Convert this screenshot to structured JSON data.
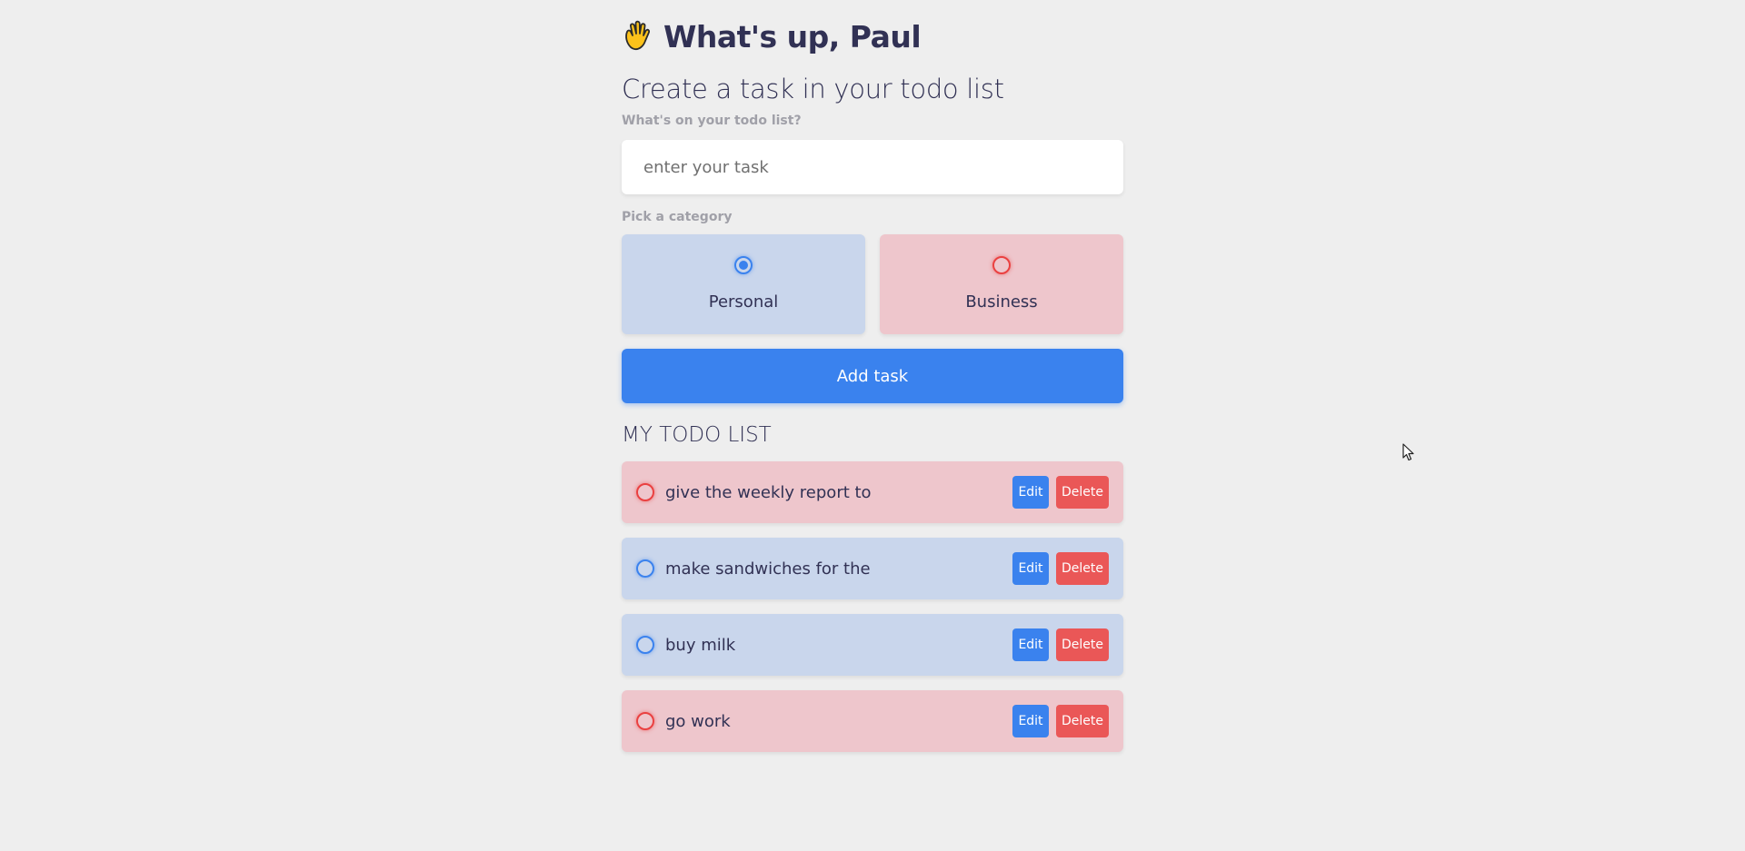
{
  "header": {
    "icon": "waving-hand-icon",
    "greeting": "What's up, Paul"
  },
  "create": {
    "title": "Create a task in your todo list",
    "task_label": "What's on your todo list?",
    "task_placeholder": "enter your task",
    "task_value": "",
    "category_label": "Pick a category",
    "categories": [
      {
        "label": "Personal",
        "selected": true,
        "color": "#3a82ee"
      },
      {
        "label": "Business",
        "selected": false,
        "color": "#ea4040"
      }
    ],
    "add_label": "Add task"
  },
  "todo": {
    "title": "MY TODO LIST",
    "items": [
      {
        "text": "give the weekly report to the boss",
        "category": "Business",
        "edit_label": "Edit",
        "delete_label": "Delete"
      },
      {
        "text": "make sandwiches for the kids",
        "category": "Personal",
        "edit_label": "Edit",
        "delete_label": "Delete"
      },
      {
        "text": "buy milk",
        "category": "Personal",
        "edit_label": "Edit",
        "delete_label": "Delete"
      },
      {
        "text": "go work",
        "category": "Business",
        "edit_label": "Edit",
        "delete_label": "Delete"
      }
    ]
  },
  "colors": {
    "background": "#eeeeee",
    "text": "#313154",
    "personal": "#3a82ee",
    "business": "#ea4040",
    "personal_bg": "#c9d6ec",
    "business_bg": "#eec6cc",
    "delete": "#ea5757"
  }
}
